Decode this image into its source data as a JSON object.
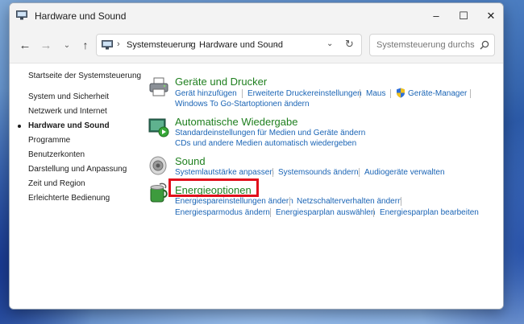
{
  "window": {
    "title": "Hardware und Sound",
    "controls": {
      "minimize": "–",
      "maximize": "☐",
      "close": "✕"
    }
  },
  "toolbar": {
    "back_glyph": "←",
    "forward_glyph": "→",
    "history_glyph": "⌄",
    "up_glyph": "↑",
    "breadcrumb": [
      "Systemsteuerung",
      "Hardware und Sound"
    ],
    "separator": "›",
    "dropdown_glyph": "⌄",
    "refresh_glyph": "↻"
  },
  "search": {
    "placeholder": "Systemsteuerung durchsuchen"
  },
  "sidebar": {
    "items": [
      {
        "label": "Startseite der Systemsteuerung",
        "current": false
      },
      {
        "label": "System und Sicherheit",
        "current": false
      },
      {
        "label": "Netzwerk und Internet",
        "current": false
      },
      {
        "label": "Hardware und Sound",
        "current": true
      },
      {
        "label": "Programme",
        "current": false
      },
      {
        "label": "Benutzerkonten",
        "current": false
      },
      {
        "label": "Darstellung und Anpassung",
        "current": false
      },
      {
        "label": "Zeit und Region",
        "current": false
      },
      {
        "label": "Erleichterte Bedienung",
        "current": false
      }
    ]
  },
  "categories": [
    {
      "title": "Geräte und Drucker",
      "icon": "printer-icon",
      "links": [
        "Gerät hinzufügen",
        "Erweiterte Druckereinstellungen",
        "Maus",
        "Geräte-Manager",
        "Windows To Go-Startoptionen ändern"
      ]
    },
    {
      "title": "Automatische Wiedergabe",
      "icon": "autoplay-icon",
      "links": [
        "Standardeinstellungen für Medien und Geräte ändern",
        "CDs und andere Medien automatisch wiedergeben"
      ]
    },
    {
      "title": "Sound",
      "icon": "speaker-icon",
      "links": [
        "Systemlautstärke anpassen",
        "Systemsounds ändern",
        "Audiogeräte verwalten"
      ]
    },
    {
      "title": "Energieoptionen",
      "icon": "power-options-icon",
      "links": [
        "Energiespareinstellungen ändern",
        "Netzschalterverhalten ändern",
        "Energiesparmodus ändern",
        "Energiesparplan auswählen",
        "Energiesparplan bearbeiten"
      ]
    }
  ],
  "colors": {
    "category_title": "#1e7f1e",
    "link": "#1a64b5",
    "highlight": "#e10f1b",
    "shield_blue": "#2f6fd6",
    "shield_yellow": "#f2c21b"
  }
}
